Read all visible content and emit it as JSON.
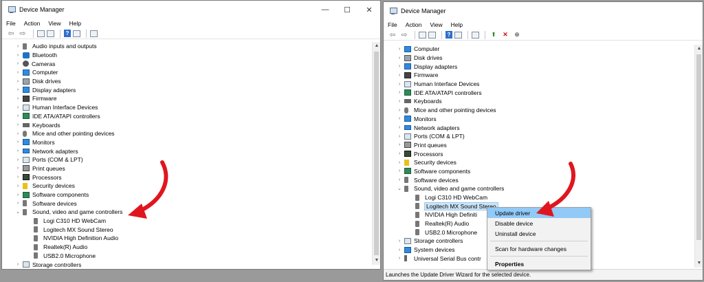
{
  "left_window": {
    "title": "Device Manager",
    "controls": {
      "minimize": "—",
      "maximize": "☐",
      "close": "✕"
    },
    "menu": [
      "File",
      "Action",
      "View",
      "Help"
    ],
    "tree": [
      {
        "label": "Audio inputs and outputs",
        "icon": "speaker"
      },
      {
        "label": "Bluetooth",
        "icon": "blue"
      },
      {
        "label": "Cameras",
        "icon": "cam"
      },
      {
        "label": "Computer",
        "icon": "monitor"
      },
      {
        "label": "Disk drives",
        "icon": "disk"
      },
      {
        "label": "Display adapters",
        "icon": "monitor"
      },
      {
        "label": "Firmware",
        "icon": "chip"
      },
      {
        "label": "Human Interface Devices",
        "icon": "generic"
      },
      {
        "label": "IDE ATA/ATAPI controllers",
        "icon": "comp"
      },
      {
        "label": "Keyboards",
        "icon": "keyboard"
      },
      {
        "label": "Mice and other pointing devices",
        "icon": "mouse"
      },
      {
        "label": "Monitors",
        "icon": "monitor"
      },
      {
        "label": "Network adapters",
        "icon": "net"
      },
      {
        "label": "Ports (COM & LPT)",
        "icon": "generic"
      },
      {
        "label": "Print queues",
        "icon": "print"
      },
      {
        "label": "Processors",
        "icon": "proc"
      },
      {
        "label": "Security devices",
        "icon": "shield"
      },
      {
        "label": "Software components",
        "icon": "comp"
      },
      {
        "label": "Software devices",
        "icon": "speaker"
      },
      {
        "label": "Sound, video and game controllers",
        "icon": "speaker",
        "expanded": true
      },
      {
        "label": "Logi C310 HD WebCam",
        "icon": "speaker",
        "child": true
      },
      {
        "label": "Logitech MX Sound Stereo",
        "icon": "speaker",
        "child": true
      },
      {
        "label": "NVIDIA High Definition Audio",
        "icon": "speaker",
        "child": true
      },
      {
        "label": "Realtek(R) Audio",
        "icon": "speaker",
        "child": true
      },
      {
        "label": "USB2.0 Microphone",
        "icon": "speaker",
        "child": true
      },
      {
        "label": "Storage controllers",
        "icon": "generic"
      }
    ]
  },
  "right_window": {
    "title": "Device Manager",
    "menu": [
      "File",
      "Action",
      "View",
      "Help"
    ],
    "tree": [
      {
        "label": "Computer",
        "icon": "monitor"
      },
      {
        "label": "Disk drives",
        "icon": "disk"
      },
      {
        "label": "Display adapters",
        "icon": "monitor"
      },
      {
        "label": "Firmware",
        "icon": "chip"
      },
      {
        "label": "Human Interface Devices",
        "icon": "generic"
      },
      {
        "label": "IDE ATA/ATAPI controllers",
        "icon": "comp"
      },
      {
        "label": "Keyboards",
        "icon": "keyboard"
      },
      {
        "label": "Mice and other pointing devices",
        "icon": "mouse"
      },
      {
        "label": "Monitors",
        "icon": "monitor"
      },
      {
        "label": "Network adapters",
        "icon": "net"
      },
      {
        "label": "Ports (COM & LPT)",
        "icon": "generic"
      },
      {
        "label": "Print queues",
        "icon": "print"
      },
      {
        "label": "Processors",
        "icon": "proc"
      },
      {
        "label": "Security devices",
        "icon": "shield"
      },
      {
        "label": "Software components",
        "icon": "comp"
      },
      {
        "label": "Software devices",
        "icon": "speaker"
      },
      {
        "label": "Sound, video and game controllers",
        "icon": "speaker",
        "expanded": true
      },
      {
        "label": "Logi C310 HD WebCam",
        "icon": "speaker",
        "child": true
      },
      {
        "label": "Logitech MX Sound Stereo",
        "icon": "speaker",
        "child": true,
        "selected": true
      },
      {
        "label": "NVIDIA High Definiti",
        "icon": "speaker",
        "child": true
      },
      {
        "label": "Realtek(R) Audio",
        "icon": "speaker",
        "child": true
      },
      {
        "label": "USB2.0 Microphone",
        "icon": "speaker",
        "child": true
      },
      {
        "label": "Storage controllers",
        "icon": "generic"
      },
      {
        "label": "System devices",
        "icon": "monitor"
      },
      {
        "label": "Universal Serial Bus contr",
        "icon": "usb"
      }
    ],
    "status": "Launches the Update Driver Wizard for the selected device."
  },
  "context_menu": {
    "items": [
      {
        "label": "Update driver",
        "highlighted": true
      },
      {
        "label": "Disable device"
      },
      {
        "label": "Uninstall device"
      },
      {
        "separator": true
      },
      {
        "label": "Scan for hardware changes"
      },
      {
        "separator": true
      },
      {
        "label": "Properties",
        "bold": true
      }
    ]
  },
  "annotation_color": "#e0161e"
}
